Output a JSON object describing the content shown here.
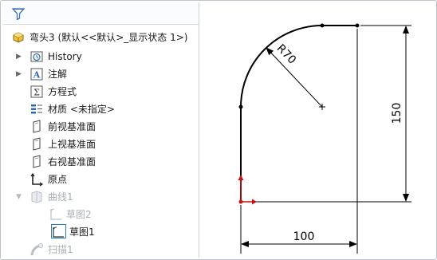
{
  "tree": {
    "root": {
      "label": "弯头3  (默认<<默认>_显示状态 1>)",
      "icon": "part-icon"
    },
    "items": [
      {
        "label": "History",
        "icon": "history-folder-icon",
        "has_arrow": true
      },
      {
        "label": "注解",
        "icon": "annotation-icon",
        "has_arrow": true
      },
      {
        "label": "方程式",
        "icon": "equation-icon",
        "has_arrow": false
      },
      {
        "label": "材质 <未指定>",
        "icon": "material-icon",
        "has_arrow": false
      },
      {
        "label": "前视基准面",
        "icon": "plane-icon",
        "has_arrow": false
      },
      {
        "label": "上视基准面",
        "icon": "plane-icon",
        "has_arrow": false
      },
      {
        "label": "右视基准面",
        "icon": "plane-icon",
        "has_arrow": false
      },
      {
        "label": "原点",
        "icon": "origin-icon",
        "has_arrow": false
      },
      {
        "label": "曲线1",
        "icon": "curve-icon",
        "has_arrow": true,
        "dimmed": true
      },
      {
        "label": "草图2",
        "icon": "sketch-icon",
        "dimmed": true
      },
      {
        "label": "草图1",
        "icon": "sketch-icon",
        "selected": true
      },
      {
        "label": "扫描1",
        "icon": "sweep-icon",
        "dimmed": true
      }
    ]
  },
  "sketch": {
    "dimensions": {
      "radius": "R70",
      "height": "150",
      "width": "100"
    },
    "colors": {
      "line": "#000000",
      "dimension": "#000000",
      "origin_x": "#cc1111",
      "origin_y": "#cc1111"
    }
  }
}
